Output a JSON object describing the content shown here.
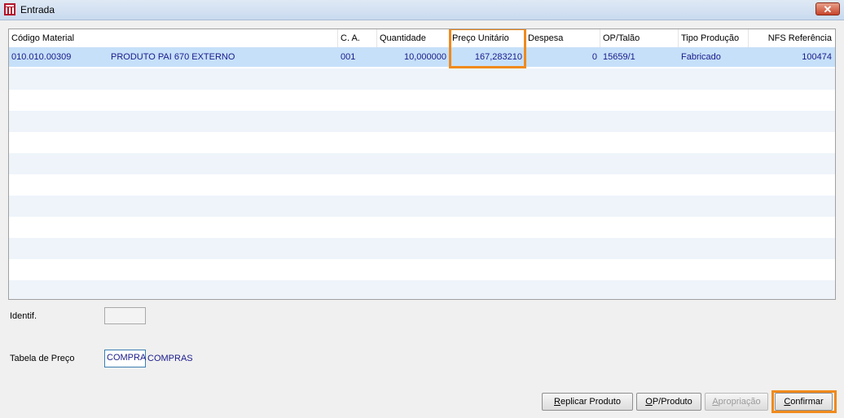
{
  "window": {
    "title": "Entrada",
    "close_label": "✕"
  },
  "grid": {
    "columns": [
      "Código Material",
      "C. A.",
      "Quantidade",
      "Preço Unitário",
      "Despesa",
      "OP/Talão",
      "Tipo Produção",
      "NFS Referência"
    ],
    "rows": [
      {
        "codigo": "010.010.00309",
        "descricao": "PRODUTO PAI 670 EXTERNO",
        "ca": "001",
        "quantidade": "10,000000",
        "preco": "167,283210",
        "despesa": "0",
        "op_talao": "15659/1",
        "tipo": "Fabricado",
        "nfs": "100474"
      }
    ]
  },
  "form": {
    "identif_label": "Identif.",
    "identif_value": "",
    "tabela_label": "Tabela de Preço",
    "tabela_value": "COMPRA",
    "tabela_desc": "COMPRAS"
  },
  "buttons": {
    "replicar": {
      "first": "R",
      "rest": "eplicar Produto"
    },
    "op_produto": {
      "first": "O",
      "rest": "P/Produto"
    },
    "apropriacao": {
      "first": "A",
      "rest": "propriação"
    },
    "confirmar": {
      "first": "C",
      "rest": "onfirmar"
    }
  },
  "colors": {
    "highlight": "#f08a1c",
    "selected_row": "#c6e0f9",
    "value_text": "#1a1a8c"
  }
}
